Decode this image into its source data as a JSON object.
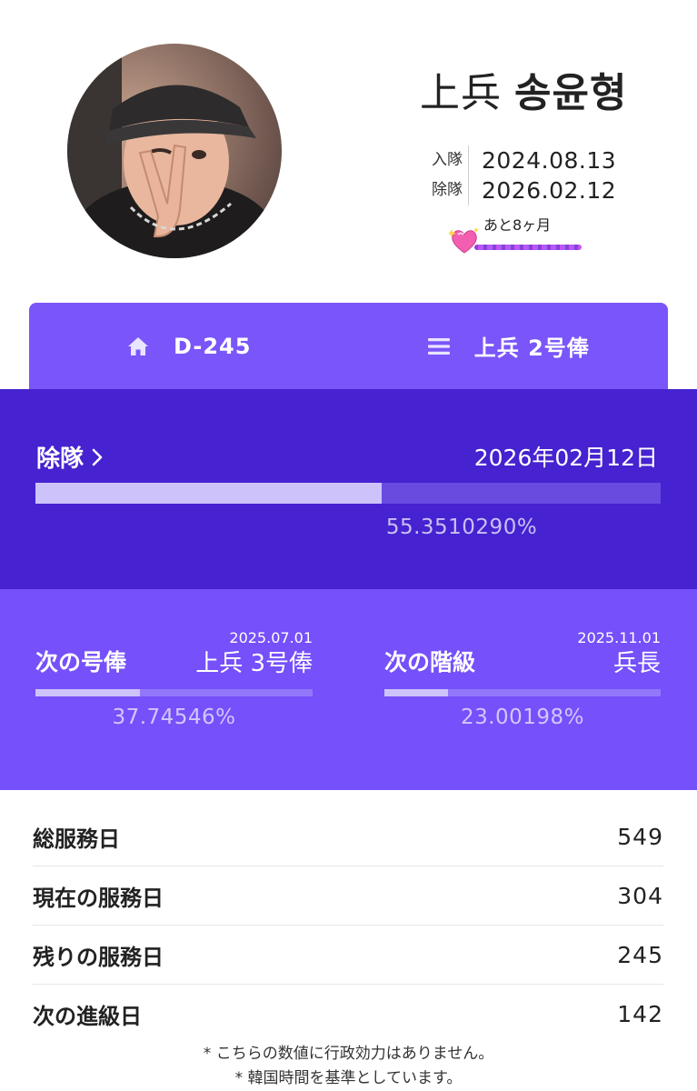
{
  "profile": {
    "rank": "上兵",
    "name": "송윤형",
    "enlist_label": "入隊",
    "enlist_date": "2024.08.13",
    "discharge_label": "除隊",
    "discharge_date": "2026.02.12",
    "remaining_note": "あと8ヶ月",
    "sticker_icon": "sparkling-heart-icon"
  },
  "tabs": [
    {
      "label": "D-245",
      "icon": "home-icon"
    },
    {
      "label": "上兵 2号俸",
      "icon": "menu-icon"
    }
  ],
  "discharge_progress": {
    "label": "除隊",
    "date": "2026年02月12日",
    "percent_text": "55.3510290%",
    "fraction": 0.55351029
  },
  "milestones": [
    {
      "title": "次の号俸",
      "date": "2025.07.01",
      "target": "上兵 3号俸",
      "percent_text": "37.74546%",
      "fraction": 0.3774546
    },
    {
      "title": "次の階級",
      "date": "2025.11.01",
      "target": "兵長",
      "percent_text": "23.00198%",
      "fraction": 0.2300198
    }
  ],
  "stats": [
    {
      "label": "総服務日",
      "value": "549"
    },
    {
      "label": "現在の服務日",
      "value": "304"
    },
    {
      "label": "残りの服務日",
      "value": "245"
    },
    {
      "label": "次の進級日",
      "value": "142"
    }
  ],
  "notes": [
    "* こちらの数値に行政効力はありません。",
    "* 韓国時間を基準としています。"
  ],
  "colors": {
    "tab_bar": "#7a55f9",
    "discharge_panel": "#4622d0",
    "milestone_panel": "#7650fa",
    "progress_fill": "#cdc3fa"
  }
}
